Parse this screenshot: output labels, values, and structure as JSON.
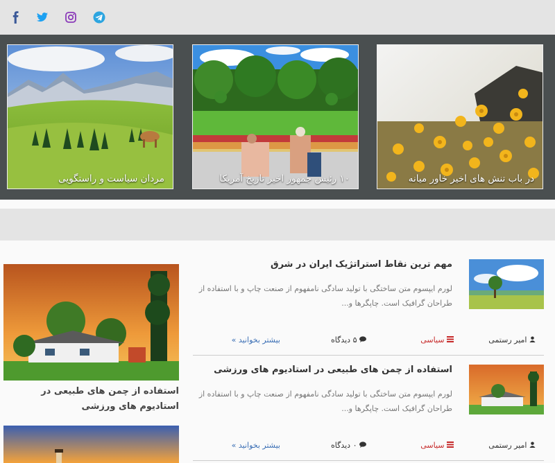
{
  "social": {
    "icons": [
      "facebook-icon",
      "twitter-icon",
      "instagram-icon",
      "telegram-icon"
    ],
    "colors": {
      "facebook": "#3b5998",
      "twitter": "#1da1f2",
      "instagram": "#8a3ab9",
      "telegram": "#2ca5e0"
    }
  },
  "slider": {
    "slides": [
      {
        "caption": "در باب تنش های اخیر خاور میانه"
      },
      {
        "caption": "۱۰ رئیس جمهور اخیر تاریخ آمریکا"
      },
      {
        "caption": "مردان سیاست و راستگویی"
      }
    ]
  },
  "articles": [
    {
      "title": "مهم ترین نقاط استراتژیک ایران در شرق",
      "excerpt": "لورم ایپسوم متن ساختگی با تولید سادگی نامفهوم از صنعت چاپ و با استفاده از طراحان گرافیک است. چاپگرها و...",
      "author": "امیر رستمی",
      "category": "سیاسی",
      "views": "۵ دیدگاه",
      "read_more": "بیشتر بخوانید »"
    },
    {
      "title": "استفاده از چمن های طبیعی در استادیوم های ورزشی",
      "excerpt": "لورم ایپسوم متن ساختگی با تولید سادگی نامفهوم از صنعت چاپ و با استفاده از طراحان گرافیک است. چاپگرها و...",
      "author": "امیر رستمی",
      "category": "سیاسی",
      "views": "۰ دیدگاه",
      "read_more": "بیشتر بخوانید »"
    }
  ],
  "featured": {
    "title": "استفاده از چمن های طبیعی در استادیوم های ورزشی"
  },
  "colors": {
    "category": "#c62828",
    "link": "#3b6fb5",
    "slider_bg": "#4a4f50",
    "band_bg": "#e4e4e4"
  }
}
